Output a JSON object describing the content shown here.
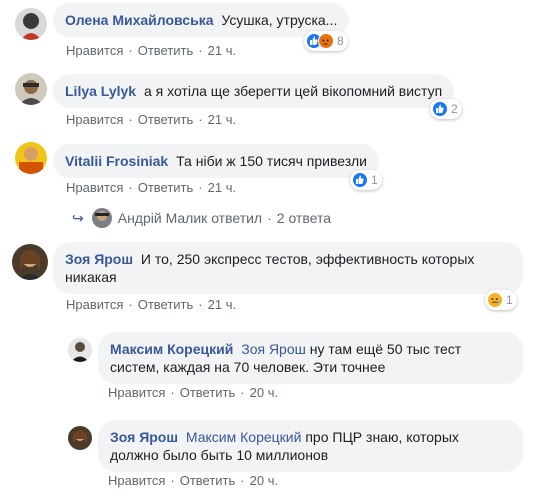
{
  "common": {
    "like_label": "Нравится",
    "reply_label": "Ответить",
    "separator": "·"
  },
  "comments": [
    {
      "author": "Олена Михайловська",
      "text": "Усушка, утруска...",
      "time": "21 ч.",
      "reactions": [
        "like",
        "angry"
      ],
      "reaction_count": "8"
    },
    {
      "author": "Lilya Lylyk",
      "text": "а я хотіла ще зберегти цей вікопомний виступ",
      "time": "21 ч.",
      "reactions": [
        "like"
      ],
      "reaction_count": "2"
    },
    {
      "author": "Vitalii Frosiniak",
      "text": "Та ніби ж 150 тисяч привезли",
      "time": "21 ч.",
      "reactions": [
        "like"
      ],
      "reaction_count": "1",
      "replies_summary": {
        "author": "Андрій Малик",
        "action": "ответил",
        "count": "2 ответа"
      }
    },
    {
      "author": "Зоя Ярош",
      "text": "И то, 250 экспресс тестов, эффективность которых никакая",
      "time": "21 ч.",
      "reactions": [
        "sad"
      ],
      "reaction_count": "1"
    }
  ],
  "replies": [
    {
      "author": "Максим Корецкий",
      "mention": "Зоя Ярош",
      "text": "ну там ещё 50 тыс тест систем, каждая на 70 человек. Эти точнее",
      "time": "20 ч."
    },
    {
      "author": "Зоя Ярош",
      "mention": "Максим Корецкий",
      "text": "про ПЦР знаю, которых должно было быть 10 миллионов",
      "time": "20 ч."
    }
  ]
}
